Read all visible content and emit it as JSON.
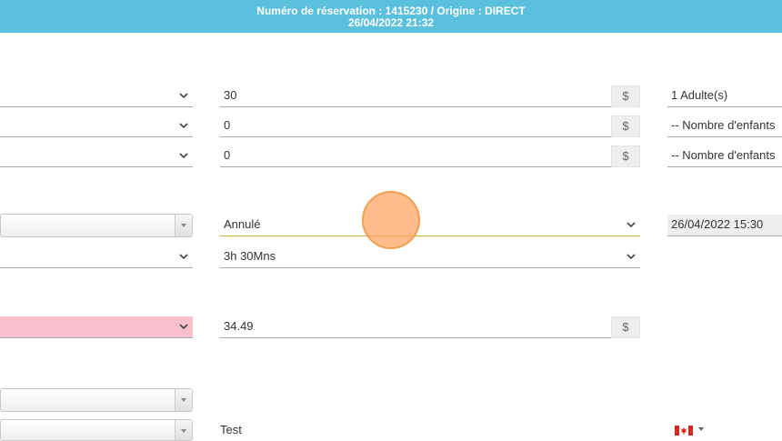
{
  "header": {
    "line1": "Numéro de réservation : 1415230 / Origine : DIRECT",
    "line2": "26/04/2022 21:32"
  },
  "price_rows": [
    {
      "amount": "30",
      "currency": "$",
      "people": "1 Adulte(s)"
    },
    {
      "amount": "0",
      "currency": "$",
      "people": "-- Nombre d'enfants"
    },
    {
      "amount": "0",
      "currency": "$",
      "people": "-- Nombre d'enfants"
    }
  ],
  "status": {
    "value": "Annulé",
    "date": "26/04/2022 15:30"
  },
  "duration": {
    "value": "3h 30Mns"
  },
  "total": {
    "amount": "34.49",
    "currency": "$"
  },
  "notes": {
    "value": "Test"
  },
  "colors": {
    "header_bg": "#5bc0de",
    "pink_select": "#f8c0cc",
    "active_underline": "#d4a94a"
  }
}
